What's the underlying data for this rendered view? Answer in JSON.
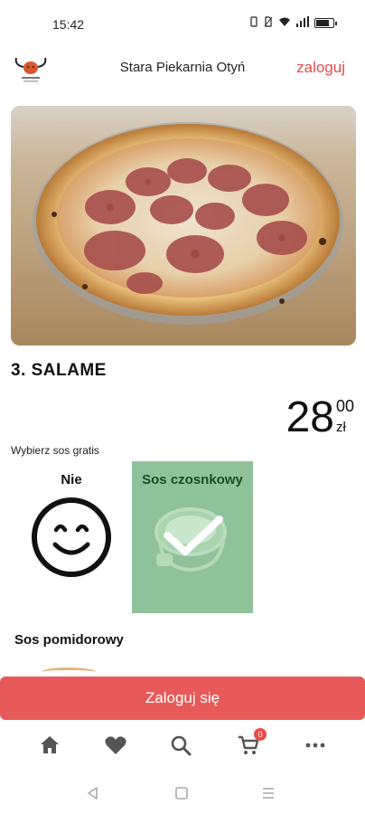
{
  "status_bar": {
    "time": "15:42",
    "battery_level": 0.8
  },
  "header": {
    "title": "Stara Piekarnia Otyń",
    "login_link": "zaloguj",
    "logo_icon": "bull-logo-icon"
  },
  "product": {
    "title": "3. SALAME",
    "price_integer": "28",
    "price_decimal": "00",
    "currency": "zł"
  },
  "sauce": {
    "label": "Wybierz sos gratis",
    "options": [
      {
        "label": "Nie",
        "icon": "smiley-face-icon",
        "selected": false
      },
      {
        "label": "Sos czosnkowy",
        "icon": "garlic-sauce-image",
        "selected": true
      },
      {
        "label": "Sos pomidorowy",
        "icon": "tomato-sauce-image",
        "selected": false
      }
    ]
  },
  "cta": {
    "label": "Zaloguj się"
  },
  "bottom_nav": {
    "items": [
      {
        "icon": "home-icon"
      },
      {
        "icon": "heart-icon"
      },
      {
        "icon": "search-icon"
      },
      {
        "icon": "cart-icon",
        "badge": "0"
      },
      {
        "icon": "more-icon"
      }
    ]
  },
  "colors": {
    "accent": "#e74c4c",
    "cta_background": "#e85a5a",
    "selected_option": "#8fc29a"
  }
}
